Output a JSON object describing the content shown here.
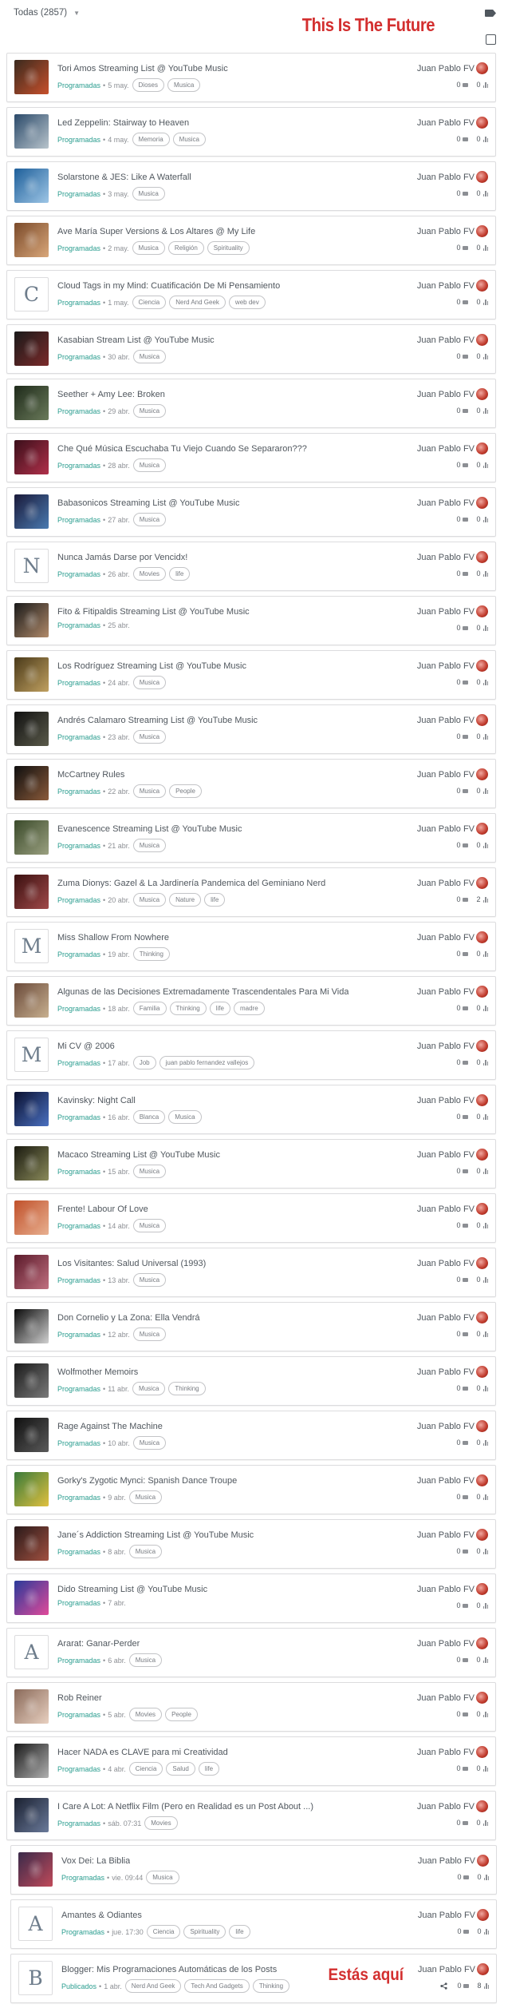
{
  "header": {
    "filter_label": "Todas (2857)",
    "site_title": "This Is The Future",
    "tag_icon": "tag-icon"
  },
  "here_label": "Estás aquí",
  "posts": [
    {
      "title": "Tori Amos Streaming List @ YouTube Music",
      "status": "Programadas",
      "date": "5 may.",
      "tags": [
        "Dioses",
        "Musica"
      ],
      "author": "Juan Pablo FV",
      "comments": "0",
      "views": "0",
      "thumb": {
        "type": "img",
        "c1": "#3a2a1e",
        "c2": "#c7502c"
      }
    },
    {
      "title": "Led Zeppelin: Stairway to Heaven",
      "status": "Programadas",
      "date": "4 may.",
      "tags": [
        "Memoria",
        "Musica"
      ],
      "author": "Juan Pablo FV",
      "comments": "0",
      "views": "0",
      "thumb": {
        "type": "img",
        "c1": "#2b4a6a",
        "c2": "#b8c4cc"
      }
    },
    {
      "title": "Solarstone & JES: Like A Waterfall",
      "status": "Programadas",
      "date": "3 may.",
      "tags": [
        "Musica"
      ],
      "author": "Juan Pablo FV",
      "comments": "0",
      "views": "0",
      "thumb": {
        "type": "img",
        "c1": "#1e5f9a",
        "c2": "#9ec6e6"
      }
    },
    {
      "title": "Ave María Super Versions & Los Altares @ My Life",
      "status": "Programadas",
      "date": "2 may.",
      "tags": [
        "Musica",
        "Religión",
        "Spirituality"
      ],
      "author": "Juan Pablo FV",
      "comments": "0",
      "views": "0",
      "thumb": {
        "type": "img",
        "c1": "#7a4a2a",
        "c2": "#d9a77a"
      }
    },
    {
      "title": "Cloud Tags in my Mind: Cuatificación De Mi Pensamiento",
      "status": "Programadas",
      "date": "1 may.",
      "tags": [
        "Ciencia",
        "Nerd And Geek",
        "web dev"
      ],
      "author": "Juan Pablo FV",
      "comments": "0",
      "views": "0",
      "thumb": {
        "type": "letter",
        "letter": "C"
      }
    },
    {
      "title": "Kasabian Stream List @ YouTube Music",
      "status": "Programadas",
      "date": "30 abr.",
      "tags": [
        "Musica"
      ],
      "author": "Juan Pablo FV",
      "comments": "0",
      "views": "0",
      "thumb": {
        "type": "img",
        "c1": "#1a1a1a",
        "c2": "#7a2a2a"
      }
    },
    {
      "title": "Seether + Amy Lee: Broken",
      "status": "Programadas",
      "date": "29 abr.",
      "tags": [
        "Musica"
      ],
      "author": "Juan Pablo FV",
      "comments": "0",
      "views": "0",
      "thumb": {
        "type": "img",
        "c1": "#1e2a1a",
        "c2": "#6a7a5a"
      }
    },
    {
      "title": "Che Qué Música Escuchaba Tu Viejo Cuando Se Separaron???",
      "status": "Programadas",
      "date": "28 abr.",
      "tags": [
        "Musica"
      ],
      "author": "Juan Pablo FV",
      "comments": "0",
      "views": "0",
      "thumb": {
        "type": "img",
        "c1": "#3a0f1a",
        "c2": "#b0304a"
      }
    },
    {
      "title": "Babasonicos Streaming List @ YouTube Music",
      "status": "Programadas",
      "date": "27 abr.",
      "tags": [
        "Musica"
      ],
      "author": "Juan Pablo FV",
      "comments": "0",
      "views": "0",
      "thumb": {
        "type": "img",
        "c1": "#1a1a3a",
        "c2": "#4a7ab0"
      }
    },
    {
      "title": "Nunca Jamás Darse por Vencidx!",
      "status": "Programadas",
      "date": "26 abr.",
      "tags": [
        "Movies",
        "life"
      ],
      "author": "Juan Pablo FV",
      "comments": "0",
      "views": "0",
      "thumb": {
        "type": "letter",
        "letter": "N"
      }
    },
    {
      "title": "Fito & Fitipaldis Streaming List @ YouTube Music",
      "status": "Programadas",
      "date": "25 abr.",
      "tags": [],
      "author": "Juan Pablo FV",
      "comments": "0",
      "views": "0",
      "thumb": {
        "type": "img",
        "c1": "#1a1a1a",
        "c2": "#b08a6a"
      }
    },
    {
      "title": "Los Rodríguez Streaming List @ YouTube Music",
      "status": "Programadas",
      "date": "24 abr.",
      "tags": [
        "Musica"
      ],
      "author": "Juan Pablo FV",
      "comments": "0",
      "views": "0",
      "thumb": {
        "type": "img",
        "c1": "#4a3a1a",
        "c2": "#c0a060"
      }
    },
    {
      "title": "Andrés Calamaro Streaming List @ YouTube Music",
      "status": "Programadas",
      "date": "23 abr.",
      "tags": [
        "Musica"
      ],
      "author": "Juan Pablo FV",
      "comments": "0",
      "views": "0",
      "thumb": {
        "type": "img",
        "c1": "#111111",
        "c2": "#5a5a4a"
      }
    },
    {
      "title": "McCartney Rules",
      "status": "Programadas",
      "date": "22 abr.",
      "tags": [
        "Musica",
        "People"
      ],
      "author": "Juan Pablo FV",
      "comments": "0",
      "views": "0",
      "thumb": {
        "type": "img",
        "c1": "#0f0f0f",
        "c2": "#8a5a3a"
      }
    },
    {
      "title": "Evanescence Streaming List @ YouTube Music",
      "status": "Programadas",
      "date": "21 abr.",
      "tags": [
        "Musica"
      ],
      "author": "Juan Pablo FV",
      "comments": "0",
      "views": "0",
      "thumb": {
        "type": "img",
        "c1": "#3a4a2a",
        "c2": "#9aa080"
      }
    },
    {
      "title": "Zuma Dionys: Gazel & La Jardinería Pandemica del Geminiano Nerd",
      "status": "Programadas",
      "date": "20 abr.",
      "tags": [
        "Musica",
        "Nature",
        "life"
      ],
      "author": "Juan Pablo FV",
      "comments": "0",
      "views": "2",
      "thumb": {
        "type": "img",
        "c1": "#3a1010",
        "c2": "#a04a4a"
      }
    },
    {
      "title": "Miss Shallow From Nowhere",
      "status": "Programadas",
      "date": "19 abr.",
      "tags": [
        "Thinking"
      ],
      "author": "Juan Pablo FV",
      "comments": "0",
      "views": "0",
      "thumb": {
        "type": "letter",
        "letter": "M"
      }
    },
    {
      "title": "Algunas de las Decisiones Extremadamente Trascendentales Para Mi Vida",
      "status": "Programadas",
      "date": "18 abr.",
      "tags": [
        "Familia",
        "Thinking",
        "life",
        "madre"
      ],
      "author": "Juan Pablo FV",
      "comments": "0",
      "views": "0",
      "thumb": {
        "type": "img",
        "c1": "#6a4a3a",
        "c2": "#c8b090"
      }
    },
    {
      "title": "Mi CV @ 2006",
      "status": "Programadas",
      "date": "17 abr.",
      "tags": [
        "Job",
        "juan pablo fernandez vallejos"
      ],
      "author": "Juan Pablo FV",
      "comments": "0",
      "views": "0",
      "thumb": {
        "type": "letter",
        "letter": "M"
      }
    },
    {
      "title": "Kavinsky: Night Call",
      "status": "Programadas",
      "date": "16 abr.",
      "tags": [
        "Blanca",
        "Musica"
      ],
      "author": "Juan Pablo FV",
      "comments": "0",
      "views": "0",
      "thumb": {
        "type": "img",
        "c1": "#0a1030",
        "c2": "#4a70c0"
      }
    },
    {
      "title": "Macaco Streaming List @ YouTube Music",
      "status": "Programadas",
      "date": "15 abr.",
      "tags": [
        "Musica"
      ],
      "author": "Juan Pablo FV",
      "comments": "0",
      "views": "0",
      "thumb": {
        "type": "img",
        "c1": "#1a1a10",
        "c2": "#8a8a5a"
      }
    },
    {
      "title": "Frente! Labour Of Love",
      "status": "Programadas",
      "date": "14 abr.",
      "tags": [
        "Musica"
      ],
      "author": "Juan Pablo FV",
      "comments": "0",
      "views": "0",
      "thumb": {
        "type": "img",
        "c1": "#c0502a",
        "c2": "#e8b090"
      }
    },
    {
      "title": "Los Visitantes: Salud Universal (1993)",
      "status": "Programadas",
      "date": "13 abr.",
      "tags": [
        "Musica"
      ],
      "author": "Juan Pablo FV",
      "comments": "0",
      "views": "0",
      "thumb": {
        "type": "img",
        "c1": "#5a1a2a",
        "c2": "#c07080"
      }
    },
    {
      "title": "Don Cornelio y La Zona: Ella Vendrá",
      "status": "Programadas",
      "date": "12 abr.",
      "tags": [
        "Musica"
      ],
      "author": "Juan Pablo FV",
      "comments": "0",
      "views": "0",
      "thumb": {
        "type": "img",
        "c1": "#0a0a0a",
        "c2": "#d0d0d0"
      }
    },
    {
      "title": "Wolfmother Memoirs",
      "status": "Programadas",
      "date": "11 abr.",
      "tags": [
        "Musica",
        "Thinking"
      ],
      "author": "Juan Pablo FV",
      "comments": "0",
      "views": "0",
      "thumb": {
        "type": "img",
        "c1": "#1a1a1a",
        "c2": "#7a7a7a"
      }
    },
    {
      "title": "Rage Against The Machine",
      "status": "Programadas",
      "date": "10 abr.",
      "tags": [
        "Musica"
      ],
      "author": "Juan Pablo FV",
      "comments": "0",
      "views": "0",
      "thumb": {
        "type": "img",
        "c1": "#101010",
        "c2": "#5a5a5a"
      }
    },
    {
      "title": "Gorky's Zygotic Mynci: Spanish Dance Troupe",
      "status": "Programadas",
      "date": "9 abr.",
      "tags": [
        "Musica"
      ],
      "author": "Juan Pablo FV",
      "comments": "0",
      "views": "0",
      "thumb": {
        "type": "img",
        "c1": "#3a7a3a",
        "c2": "#e0c040"
      }
    },
    {
      "title": "Jane´s Addiction Streaming List @ YouTube Music",
      "status": "Programadas",
      "date": "8 abr.",
      "tags": [
        "Musica"
      ],
      "author": "Juan Pablo FV",
      "comments": "0",
      "views": "0",
      "thumb": {
        "type": "img",
        "c1": "#2a1a1a",
        "c2": "#a05040"
      }
    },
    {
      "title": "Dido Streaming List @ YouTube Music",
      "status": "Programadas",
      "date": "7 abr.",
      "tags": [],
      "author": "Juan Pablo FV",
      "comments": "0",
      "views": "0",
      "thumb": {
        "type": "img",
        "c1": "#2a3a9a",
        "c2": "#e04a9a"
      }
    },
    {
      "title": "Ararat: Ganar-Perder",
      "status": "Programadas",
      "date": "6 abr.",
      "tags": [
        "Musica"
      ],
      "author": "Juan Pablo FV",
      "comments": "0",
      "views": "0",
      "thumb": {
        "type": "letter",
        "letter": "A"
      }
    },
    {
      "title": "Rob Reiner",
      "status": "Programadas",
      "date": "5 abr.",
      "tags": [
        "Movies",
        "People"
      ],
      "author": "Juan Pablo FV",
      "comments": "0",
      "views": "0",
      "thumb": {
        "type": "img",
        "c1": "#8a6a5a",
        "c2": "#e8d0c0"
      }
    },
    {
      "title": "Hacer NADA es CLAVE para mi Creatividad",
      "status": "Programadas",
      "date": "4 abr.",
      "tags": [
        "Ciencia",
        "Salud",
        "life"
      ],
      "author": "Juan Pablo FV",
      "comments": "0",
      "views": "0",
      "thumb": {
        "type": "img",
        "c1": "#1a1a1a",
        "c2": "#b0b0b0"
      }
    },
    {
      "title": "I Care A Lot: A Netflix Film (Pero en Realidad es un Post About ...)",
      "status": "Programadas",
      "date": "sáb. 07:31",
      "tags": [
        "Movies"
      ],
      "author": "Juan Pablo FV",
      "comments": "0",
      "views": "0",
      "thumb": {
        "type": "img",
        "c1": "#1a2030",
        "c2": "#6a7a9a"
      }
    },
    {
      "title": "Vox Dei: La Biblia",
      "status": "Programadas",
      "date": "vie. 09:44",
      "tags": [
        "Musica"
      ],
      "author": "Juan Pablo FV",
      "comments": "0",
      "views": "0",
      "indent": true,
      "thumb": {
        "type": "img",
        "c1": "#3a2a4a",
        "c2": "#c04a5a"
      }
    },
    {
      "title": "Amantes & Odiantes",
      "status": "Programadas",
      "date": "jue. 17:30",
      "tags": [
        "Ciencia",
        "Spirituality",
        "life"
      ],
      "author": "Juan Pablo FV",
      "comments": "0",
      "views": "0",
      "indent": true,
      "thumb": {
        "type": "letter",
        "letter": "A"
      }
    },
    {
      "title": "Blogger: Mis Programaciones Automáticas de los Posts",
      "status": "Publicados",
      "date": "1 abr.",
      "tags": [
        "Nerd And Geek",
        "Tech And Gadgets",
        "Thinking"
      ],
      "author": "Juan Pablo FV",
      "comments": "0",
      "views": "8",
      "current": true,
      "thumb": {
        "type": "letter",
        "letter": "B"
      }
    }
  ]
}
